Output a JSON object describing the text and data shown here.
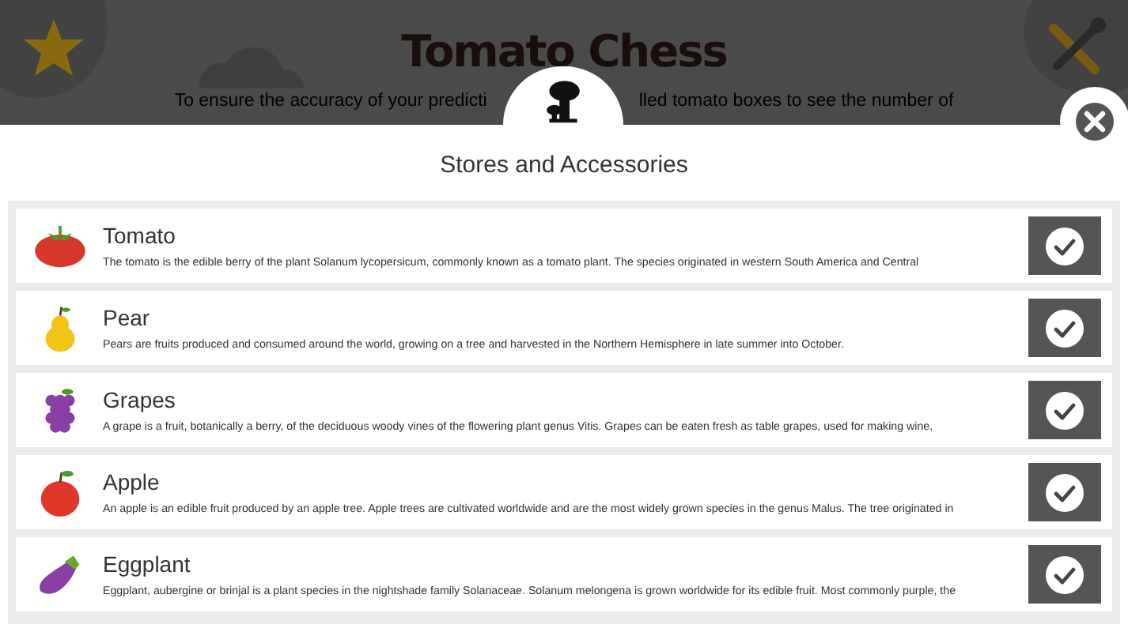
{
  "background": {
    "title": "Tomato Chess",
    "line_1_left": "To ensure the accuracy of your predicti",
    "line_1_right": "lled tomato boxes to see the number of"
  },
  "dialog": {
    "title": "Stores and Accessories"
  },
  "items": [
    {
      "kind": "tomato",
      "name": "Tomato",
      "description": "The tomato is the edible berry of the plant Solanum lycopersicum, commonly known as a tomato plant. The species originated in western South America and Central",
      "checked": true
    },
    {
      "kind": "pear",
      "name": "Pear",
      "description": "Pears are fruits produced and consumed around the world, growing on a tree and harvested in the Northern Hemisphere in late summer into October.",
      "checked": true
    },
    {
      "kind": "grapes",
      "name": "Grapes",
      "description": "A grape is a fruit, botanically a berry, of the deciduous woody vines of the flowering plant genus Vitis. Grapes can be eaten fresh as table grapes, used for making wine,",
      "checked": true
    },
    {
      "kind": "apple",
      "name": "Apple",
      "description": "An apple is an edible fruit produced by an apple tree. Apple trees are cultivated worldwide and are the most widely grown species in the genus Malus. The tree originated in",
      "checked": true
    },
    {
      "kind": "eggplant",
      "name": "Eggplant",
      "description": "Eggplant, aubergine or brinjal is a plant species in the nightshade family Solanaceae. Solanum melongena is grown worldwide for its edible fruit. Most commonly purple, the",
      "checked": true
    }
  ]
}
